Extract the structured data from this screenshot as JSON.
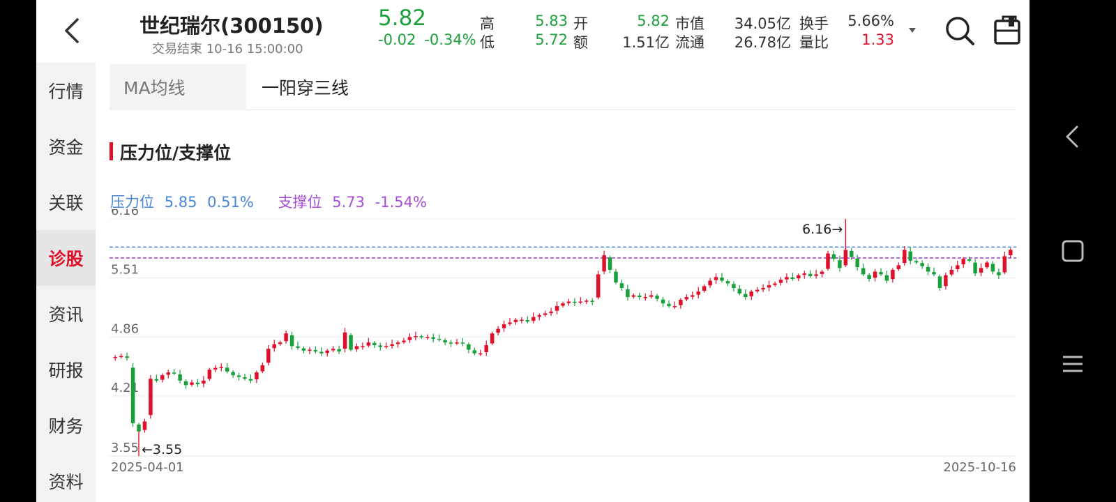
{
  "header": {
    "stock_name": "世纪瑞尔(300150)",
    "status": "交易结束 10-16 15:00:00",
    "price": "5.82",
    "change": "-0.02",
    "change_pct": "-0.34%",
    "quotes": [
      {
        "label": "高",
        "value": "5.83"
      },
      {
        "label": "低",
        "value": "5.72"
      },
      {
        "label": "开",
        "value": "5.82"
      },
      {
        "label": "额",
        "value": "1.51亿"
      },
      {
        "label": "市值",
        "value": "34.05亿"
      },
      {
        "label": "流通",
        "value": "26.78亿"
      },
      {
        "label": "换手",
        "value": "5.66%"
      },
      {
        "label": "量比",
        "value": "1.33"
      }
    ]
  },
  "nav": {
    "items": [
      "行情",
      "资金",
      "关联",
      "诊股",
      "资讯",
      "研报",
      "财务",
      "资料"
    ],
    "active_index": 3
  },
  "tabs": [
    "MA均线",
    "一阳穿三线"
  ],
  "section": {
    "title": "压力位/支撑位"
  },
  "levels": {
    "resistance_label": "压力位",
    "resistance_value": "5.85",
    "resistance_pct": "0.51%",
    "support_label": "支撑位",
    "support_value": "5.73",
    "support_pct": "-1.54%"
  },
  "colors": {
    "up": "#e0102a",
    "down": "#19a03a",
    "resistance": "#4a86d6",
    "support": "#a64dd6"
  },
  "chart_data": {
    "type": "candlestick",
    "y_ticks": [
      "6.16",
      "5.51",
      "4.86",
      "4.21",
      "3.55"
    ],
    "y_tick_values": [
      6.16,
      5.51,
      4.86,
      4.21,
      3.55
    ],
    "x_labels": [
      "2025-04-01",
      "2025-10-16"
    ],
    "max_annotation": "6.16",
    "min_annotation": "3.55",
    "resistance": 5.85,
    "support": 5.73,
    "closes": [
      4.64,
      4.65,
      4.63,
      3.91,
      3.82,
      3.93,
      4.4,
      4.38,
      4.44,
      4.47,
      4.46,
      4.38,
      4.33,
      4.36,
      4.34,
      4.38,
      4.5,
      4.52,
      4.53,
      4.48,
      4.44,
      4.42,
      4.4,
      4.38,
      4.47,
      4.55,
      4.73,
      4.78,
      4.8,
      4.9,
      4.76,
      4.74,
      4.71,
      4.72,
      4.7,
      4.68,
      4.71,
      4.73,
      4.7,
      4.91,
      4.72,
      4.76,
      4.76,
      4.8,
      4.77,
      4.75,
      4.76,
      4.78,
      4.8,
      4.82,
      4.86,
      4.87,
      4.86,
      4.86,
      4.84,
      4.83,
      4.8,
      4.79,
      4.8,
      4.79,
      4.72,
      4.68,
      4.68,
      4.77,
      4.9,
      4.95,
      5.0,
      5.02,
      5.05,
      5.05,
      5.03,
      5.08,
      5.1,
      5.12,
      5.14,
      5.2,
      5.23,
      5.25,
      5.24,
      5.25,
      5.26,
      5.25,
      5.55,
      5.76,
      5.6,
      5.46,
      5.4,
      5.3,
      5.32,
      5.3,
      5.3,
      5.32,
      5.28,
      5.23,
      5.2,
      5.2,
      5.27,
      5.3,
      5.32,
      5.36,
      5.42,
      5.48,
      5.52,
      5.48,
      5.45,
      5.4,
      5.34,
      5.3,
      5.36,
      5.38,
      5.4,
      5.43,
      5.45,
      5.49,
      5.52,
      5.5,
      5.54,
      5.56,
      5.53,
      5.55,
      5.58,
      5.78,
      5.72,
      5.62,
      5.82,
      5.74,
      5.63,
      5.55,
      5.5,
      5.58,
      5.55,
      5.48,
      5.6,
      5.65,
      5.82,
      5.7,
      5.68,
      5.64,
      5.58,
      5.55,
      5.4,
      5.54,
      5.6,
      5.65,
      5.72,
      5.7,
      5.56,
      5.62,
      5.68,
      5.58,
      5.54,
      5.75,
      5.82
    ]
  }
}
